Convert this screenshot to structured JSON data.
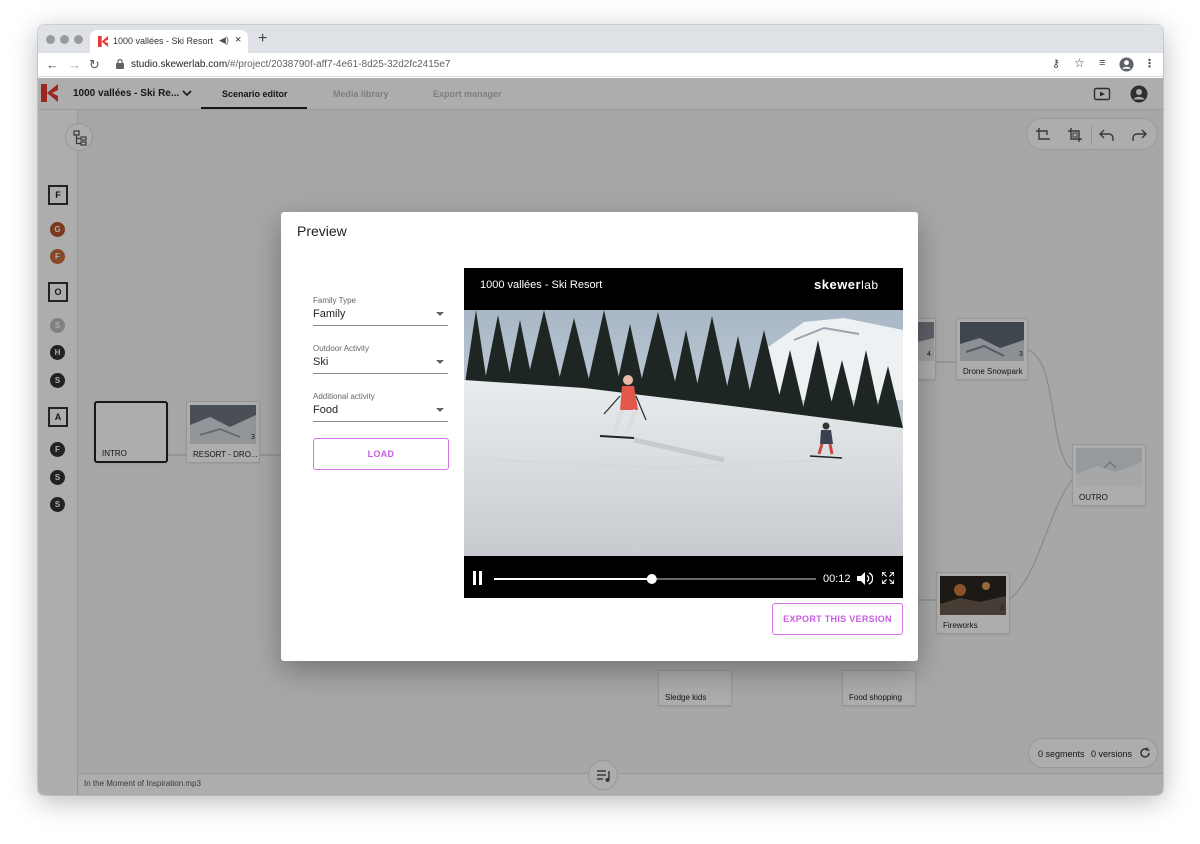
{
  "browser": {
    "tab_title": "1000 vallées - Ski Resort -",
    "url_host": "studio.skewerlab.com",
    "url_path": "/#/project/2038790f-aff7-4e61-8d25-32d2fc2415e7"
  },
  "app": {
    "project_name": "1000 vallées - Ski Re...",
    "tabs": [
      {
        "label": "Scenario editor",
        "active": true
      },
      {
        "label": "Media library",
        "active": false
      },
      {
        "label": "Export manager",
        "active": false
      }
    ],
    "accent_color": "#d673e6"
  },
  "sidebar": {
    "items": [
      {
        "letter": "F",
        "kind": "square"
      },
      {
        "letter": "G",
        "kind": "circle",
        "color": "#b5532f"
      },
      {
        "letter": "F",
        "kind": "circle",
        "color": "#c76a3b"
      },
      {
        "letter": "O",
        "kind": "square"
      },
      {
        "letter": "S",
        "kind": "circle",
        "color": "#bdbdbd"
      },
      {
        "letter": "H",
        "kind": "circle",
        "color": "#333333"
      },
      {
        "letter": "S",
        "kind": "circle",
        "color": "#333333"
      },
      {
        "letter": "A",
        "kind": "square"
      },
      {
        "letter": "F",
        "kind": "circle",
        "color": "#333333"
      },
      {
        "letter": "S",
        "kind": "circle",
        "color": "#333333"
      },
      {
        "letter": "S",
        "kind": "circle",
        "color": "#333333"
      }
    ]
  },
  "nodes": {
    "intro": {
      "label": "INTRO"
    },
    "resort": {
      "label": "RESORT - DRO...",
      "count": "3"
    },
    "drone": {
      "label": "Drone Snowpark",
      "count": "3"
    },
    "outro": {
      "label": "OUTRO"
    },
    "fireworks": {
      "label": "Fireworks",
      "count": "3"
    },
    "sledge": {
      "label": "Sledge kids"
    },
    "food_shopping": {
      "label": "Food shopping"
    },
    "partial_count": "4"
  },
  "footer": {
    "audio_file": "In the Moment of Inspiration.mp3",
    "segments_label": "0 segments",
    "versions_label": "0 versions"
  },
  "modal": {
    "title": "Preview",
    "fields": [
      {
        "label": "Family Type",
        "value": "Family"
      },
      {
        "label": "Outdoor Activity",
        "value": "Ski"
      },
      {
        "label": "Additional activity",
        "value": "Food"
      }
    ],
    "load_label": "LOAD",
    "export_label": "EXPORT THIS VERSION",
    "player": {
      "title": "1000 vallées - Ski Resort",
      "brand_main": "skewer",
      "brand_suffix": "lab",
      "time": "00:12",
      "progress": 0.49
    }
  }
}
